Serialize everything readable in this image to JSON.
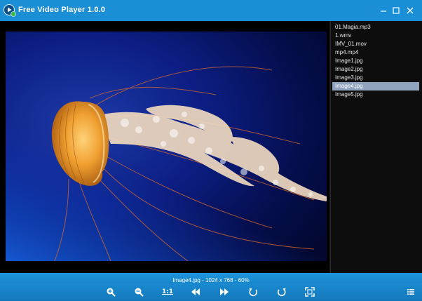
{
  "window": {
    "title": "Free Video Player 1.0.0",
    "icons": {
      "app": "play-logo-icon",
      "minimize": "minimize-icon",
      "maximize": "maximize-icon",
      "close": "close-icon"
    }
  },
  "viewer": {
    "image_subject": "jellyfish-photo"
  },
  "playlist": {
    "items": [
      {
        "label": "01.Magia.mp3"
      },
      {
        "label": "1.wmv"
      },
      {
        "label": "IMV_01.mov"
      },
      {
        "label": "mp4.mp4"
      },
      {
        "label": "Image1.jpg"
      },
      {
        "label": "Image2.jpg"
      },
      {
        "label": "Image3.jpg"
      },
      {
        "label": "Image4.jpg"
      },
      {
        "label": "Image5.jpg"
      }
    ],
    "selected": "Image4.jpg"
  },
  "status": {
    "text": "Image4.jpg - 1024 x 768 - 60%"
  },
  "toolbar": {
    "ratio_label": "1:1",
    "icons": [
      "zoom-in-icon",
      "zoom-out-icon",
      "actual-size-icon",
      "previous-icon",
      "next-icon",
      "rotate-left-icon",
      "rotate-right-icon",
      "fit-screen-icon",
      "playlist-icon"
    ]
  },
  "colors": {
    "titlebar": "#1a8fd6",
    "toolbar": "#1a8ad1",
    "selected_item": "#8fa3bf",
    "background": "#000000"
  }
}
